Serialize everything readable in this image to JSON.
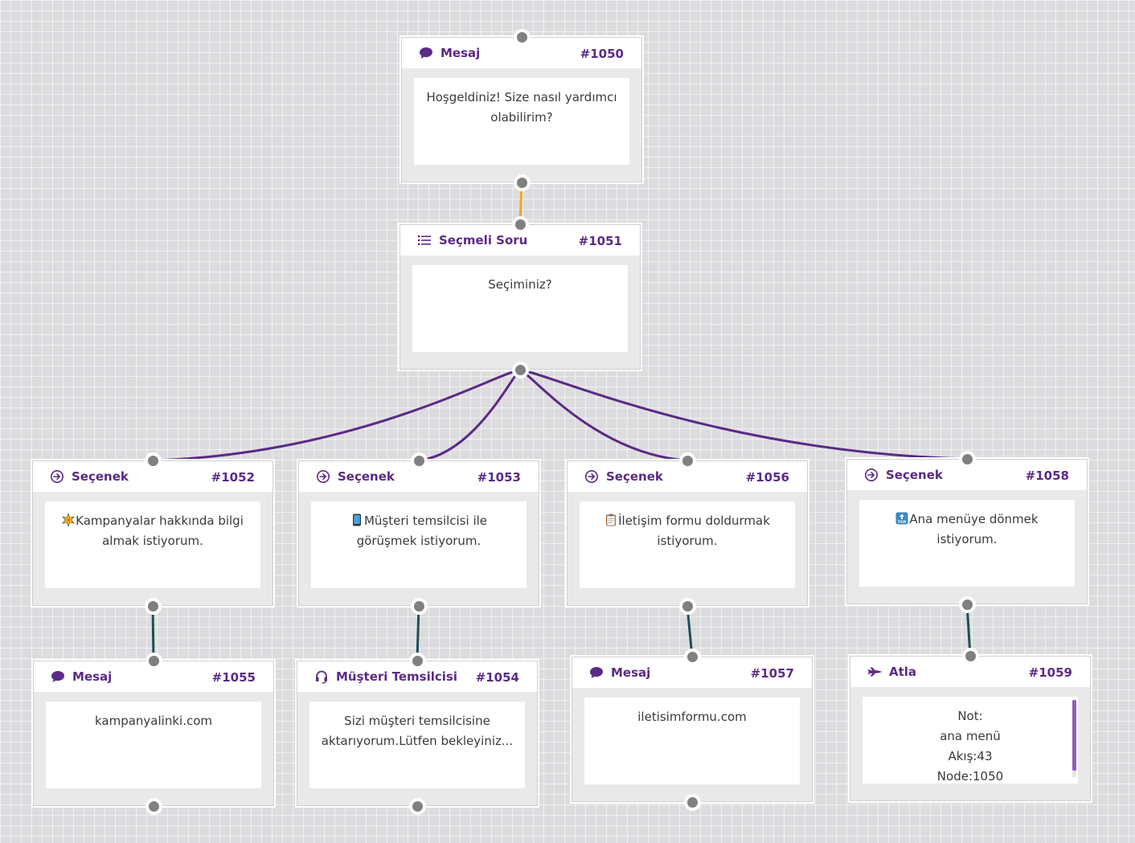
{
  "nodes": [
    {
      "key": "n1050",
      "type": "Mesaj",
      "id": "#1050",
      "icon": "chat-bubble-icon",
      "lines": [
        "Hoşgeldiniz! Size nasıl yardımcı",
        "olabilirim?"
      ]
    },
    {
      "key": "n1051",
      "type": "Seçmeli Soru",
      "id": "#1051",
      "icon": "list-icon",
      "lines": [
        "Seçiminiz?"
      ]
    },
    {
      "key": "n1052",
      "type": "Seçenek",
      "id": "#1052",
      "icon": "arrow-circle-icon",
      "lines": [
        "Kampanyalar hakkında bilgi",
        "almak istiyorum."
      ],
      "emoji": "sparkle-emoji"
    },
    {
      "key": "n1053",
      "type": "Seçenek",
      "id": "#1053",
      "icon": "arrow-circle-icon",
      "lines": [
        "Müşteri temsilcisi ile",
        "görüşmek istiyorum."
      ],
      "emoji": "mobile-phone-emoji"
    },
    {
      "key": "n1056",
      "type": "Seçenek",
      "id": "#1056",
      "icon": "arrow-circle-icon",
      "lines": [
        "İletişim formu doldurmak",
        "istiyorum."
      ],
      "emoji": "clipboard-emoji"
    },
    {
      "key": "n1058",
      "type": "Seçenek",
      "id": "#1058",
      "icon": "arrow-circle-icon",
      "lines": [
        "Ana menüye dönmek",
        "istiyorum."
      ],
      "emoji": "top-arrow-emoji"
    },
    {
      "key": "n1055",
      "type": "Mesaj",
      "id": "#1055",
      "icon": "chat-bubble-icon",
      "lines": [
        "kampanyalinki.com"
      ]
    },
    {
      "key": "n1054",
      "type": "Müşteri Temsilcisi",
      "id": "#1054",
      "icon": "headset-icon",
      "lines": [
        "Sizi müşteri temsilcisine",
        "aktarıyorum.Lütfen bekleyiniz..."
      ]
    },
    {
      "key": "n1057",
      "type": "Mesaj",
      "id": "#1057",
      "icon": "chat-bubble-icon",
      "lines": [
        "iletisimformu.com"
      ]
    },
    {
      "key": "n1059",
      "type": "Atla",
      "id": "#1059",
      "icon": "rocket-icon",
      "lines": [
        "Not:",
        "ana menü",
        "Akış:43",
        "Node:1050"
      ]
    }
  ],
  "connections": [
    {
      "from": "n1050",
      "to": "n1051",
      "color": "#f5a623"
    },
    {
      "from": "n1051",
      "to": "n1052",
      "color": "#5b2a86"
    },
    {
      "from": "n1051",
      "to": "n1053",
      "color": "#5b2a86"
    },
    {
      "from": "n1051",
      "to": "n1056",
      "color": "#5b2a86"
    },
    {
      "from": "n1051",
      "to": "n1058",
      "color": "#5b2a86"
    },
    {
      "from": "n1052",
      "to": "n1055",
      "color": "#1d4f57"
    },
    {
      "from": "n1053",
      "to": "n1054",
      "color": "#1d4f57"
    },
    {
      "from": "n1056",
      "to": "n1057",
      "color": "#1d4f57"
    },
    {
      "from": "n1058",
      "to": "n1059",
      "color": "#1d4f57"
    }
  ],
  "colors": {
    "accent": "#5b2a86",
    "port": "#808080",
    "canvas": "#dcdcdf"
  }
}
